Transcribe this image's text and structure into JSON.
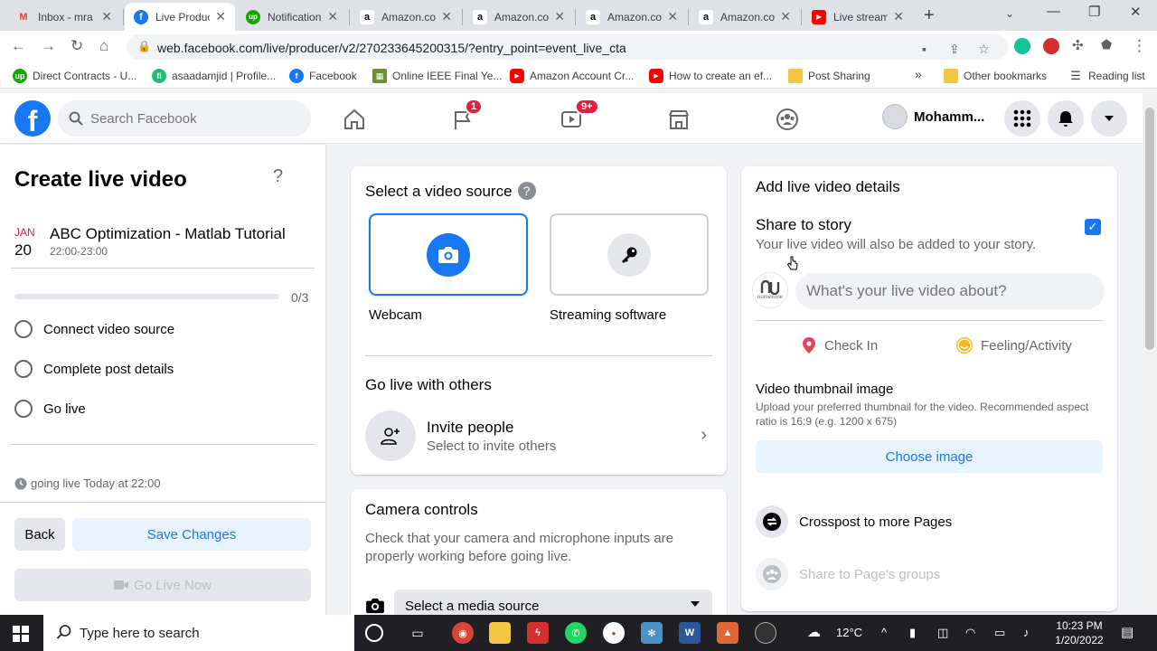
{
  "browser": {
    "tabs": [
      {
        "title": "Inbox - mra",
        "favicon": "gmail-icon",
        "active": false
      },
      {
        "title": "Live Produc",
        "favicon": "facebook-icon",
        "active": true
      },
      {
        "title": "Notification",
        "favicon": "upwork-icon",
        "active": false
      },
      {
        "title": "Amazon.co",
        "favicon": "amazon-icon",
        "active": false
      },
      {
        "title": "Amazon.co",
        "favicon": "amazon-icon",
        "active": false
      },
      {
        "title": "Amazon.co",
        "favicon": "amazon-icon",
        "active": false
      },
      {
        "title": "Amazon.co",
        "favicon": "amazon-icon",
        "active": false
      },
      {
        "title": "Live stream",
        "favicon": "youtube-icon",
        "active": false
      }
    ],
    "url": "web.facebook.com/live/producer/v2/270233645200315/?entry_point=event_live_cta",
    "bookmarks": [
      {
        "label": "Direct Contracts - U...",
        "icon": "upwork-icon"
      },
      {
        "label": "asaadamjid | Profile...",
        "icon": "fiverr-icon"
      },
      {
        "label": "Facebook",
        "icon": "facebook-icon"
      },
      {
        "label": "Online IEEE Final Ye...",
        "icon": "ieee-icon"
      },
      {
        "label": "Amazon Account Cr...",
        "icon": "youtube-icon"
      },
      {
        "label": "How to create an ef...",
        "icon": "youtube-icon"
      },
      {
        "label": "Post Sharing",
        "icon": "folder-icon"
      }
    ],
    "overflow": "»",
    "other_bookmarks": "Other bookmarks",
    "reading_list": "Reading list"
  },
  "fbnav": {
    "search_placeholder": "Search Facebook",
    "pages_badge": "1",
    "watch_badge": "9+",
    "profile_name": "Mohamm..."
  },
  "left": {
    "title": "Create live video",
    "help": "?",
    "event": {
      "month": "JAN",
      "day": "20",
      "name": "ABC Optimization - Matlab Tutorial",
      "time": "22:00-23:00"
    },
    "progress": {
      "completed": 0,
      "total": 3,
      "label": "0/3"
    },
    "steps": [
      "Connect video source",
      "Complete post details",
      "Go live"
    ],
    "note": "going live Today at 22:00",
    "back": "Back",
    "save": "Save Changes",
    "golive": "Go Live Now"
  },
  "middle": {
    "source_title": "Select a video source",
    "sources": [
      {
        "label": "Webcam",
        "selected": true,
        "icon": "camera-icon"
      },
      {
        "label": "Streaming software",
        "selected": false,
        "icon": "key-icon"
      }
    ],
    "others_title": "Go live with others",
    "invite_title": "Invite people",
    "invite_sub": "Select to invite others",
    "camera_title": "Camera controls",
    "camera_desc": "Check that your camera and microphone inputs are properly working before going live.",
    "media_select": "Select a media source"
  },
  "right": {
    "title": "Add live video details",
    "story_title": "Share to story",
    "story_sub": "Your live video will also be added to your story.",
    "story_checked": true,
    "page_avatar_text": "numexone",
    "about_placeholder": "What's your live video about?",
    "check_in": "Check In",
    "feeling": "Feeling/Activity",
    "thumb_title": "Video thumbnail image",
    "thumb_sub": "Upload your preferred thumbnail for the video. Recommended aspect ratio is 16:9 (e.g. 1200 x 675)",
    "choose": "Choose image",
    "crosspost": "Crosspost to more Pages",
    "groups": "Share to Page's groups"
  },
  "taskbar": {
    "search": "Type here to search",
    "temp": "12°C",
    "time": "10:23 PM",
    "date": "1/20/2022"
  },
  "colors": {
    "fb_blue": "#1877f2",
    "badge_red": "#e41e3f"
  }
}
